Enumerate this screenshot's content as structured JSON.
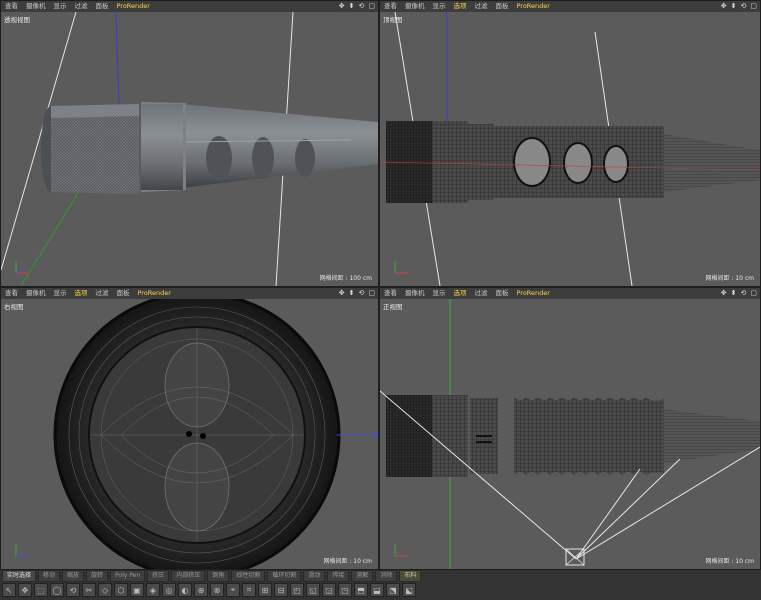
{
  "viewports": [
    {
      "id": "persp",
      "name": "透视视图",
      "grid": "网格间距 : 100 cm",
      "menu": [
        "查看",
        "摄像机",
        "显示",
        "过滤",
        "面板",
        "ProRender"
      ],
      "highlight": -1
    },
    {
      "id": "top",
      "name": "顶视图",
      "grid": "网格间距 : 10 cm",
      "menu": [
        "查看",
        "摄像机",
        "显示",
        "选项",
        "过滤",
        "面板",
        "ProRender"
      ],
      "highlight": 3
    },
    {
      "id": "right",
      "name": "右视图",
      "grid": "网格间距 : 10 cm",
      "menu": [
        "查看",
        "摄像机",
        "显示",
        "选项",
        "过滤",
        "面板",
        "ProRender"
      ],
      "highlight": 3
    },
    {
      "id": "front",
      "name": "正视图",
      "grid": "网格间距 : 10 cm",
      "menu": [
        "查看",
        "摄像机",
        "显示",
        "选项",
        "过滤",
        "面板",
        "ProRender"
      ],
      "highlight": 3
    }
  ],
  "viewport_controls": [
    "✥",
    "⬍",
    "⟲",
    "▢"
  ],
  "bottom_tabs": [
    {
      "label": "实时选择",
      "state": "active"
    },
    {
      "label": "移动",
      "state": ""
    },
    {
      "label": "缩放",
      "state": ""
    },
    {
      "label": "旋转",
      "state": ""
    },
    {
      "label": "Poly Pen",
      "state": ""
    },
    {
      "label": "挤压",
      "state": ""
    },
    {
      "label": "内部挤压",
      "state": ""
    },
    {
      "label": "倒角",
      "state": ""
    },
    {
      "label": "线性切割",
      "state": ""
    },
    {
      "label": "循环切割",
      "state": ""
    },
    {
      "label": "滑动",
      "state": ""
    },
    {
      "label": "焊接",
      "state": ""
    },
    {
      "label": "溶解",
      "state": ""
    },
    {
      "label": "消除",
      "state": ""
    },
    {
      "label": "布料",
      "state": "accent"
    }
  ],
  "tool_icons": [
    "↖",
    "✥",
    "⬚",
    "◯",
    "⟲",
    "✂",
    "◇",
    "⬡",
    "▣",
    "◈",
    "◎",
    "◐",
    "⊕",
    "⊗",
    "⌖",
    "⌗",
    "⊞",
    "⊟",
    "◰",
    "◱",
    "◲",
    "◳",
    "⬒",
    "⬓",
    "⬔",
    "⬕"
  ]
}
